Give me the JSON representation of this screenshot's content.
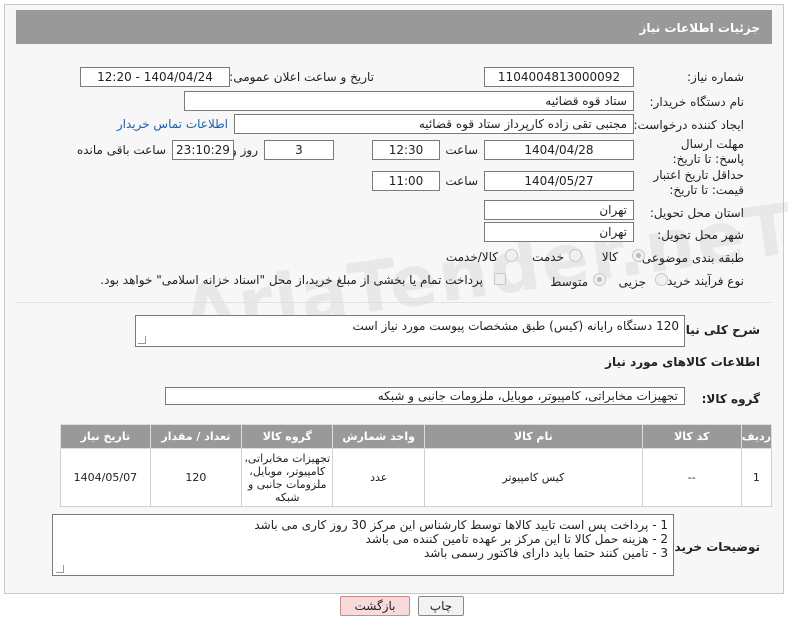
{
  "header": {
    "title": "جزئیات اطلاعات نیاز"
  },
  "fields": {
    "need_number_label": "شماره نیاز:",
    "need_number": "1104004813000092",
    "announce_label": "تاریخ و ساعت اعلان عمومی:",
    "announce_value": "1404/04/24 - 12:20",
    "buyer_org_label": "نام دستگاه خریدار:",
    "buyer_org": "ستاد قوه قضائیه",
    "creator_label": "ایجاد کننده درخواست:",
    "creator": "مجتبی تقی زاده کارپرداز ستاد قوه قضائیه",
    "contact_link": "اطلاعات تماس خریدار",
    "reply_deadline_label": "مهلت ارسال پاسخ: تا تاریخ:",
    "reply_date": "1404/04/28",
    "time_label": "ساعت",
    "reply_time": "12:30",
    "days_value": "3",
    "days_label": "روز و",
    "remaining_time": "23:10:29",
    "remaining_label": "ساعت باقی مانده",
    "price_validity_label": "حداقل تاریخ اعتبار قیمت: تا تاریخ:",
    "price_date": "1404/05/27",
    "time_label2": "ساعت",
    "price_time": "11:00",
    "province_label": "استان محل تحویل:",
    "province": "تهران",
    "city_label": "شهر محل تحویل:",
    "city": "تهران",
    "category_label": "طبقه بندی موضوعی:",
    "category_goods": "کالا",
    "category_service": "خدمت",
    "category_both": "کالا/خدمت",
    "process_label": "نوع فرآیند خرید :",
    "process_partial": "جزیی",
    "process_medium": "متوسط",
    "payment_note": "پرداخت تمام یا بخشی از مبلغ خرید،از محل \"اسناد خزانه اسلامی\" خواهد بود."
  },
  "description": {
    "label": "شرح کلی نیاز:",
    "text": "120 دستگاه رایانه (کیس) طبق مشخصات پیوست مورد نیاز است"
  },
  "goods_section": {
    "title": "اطلاعات کالاهای مورد نیاز",
    "group_label": "گروه کالا:",
    "group_value": "تجهیزات مخابراتی، کامپیوتر، موبایل، ملزومات جانبی و شبکه"
  },
  "table": {
    "headers": [
      "ردیف",
      "کد کالا",
      "نام کالا",
      "واحد شمارش",
      "گروه کالا",
      "تعداد / مقدار",
      "تاریخ نیاز"
    ],
    "rows": [
      [
        "1",
        "--",
        "کیس کامپیوتر",
        "عدد",
        "تجهیزات مخابراتی، کامپیوتر، موبایل، ملزومات جانبی و شبکه",
        "120",
        "1404/05/07"
      ]
    ]
  },
  "buyer_notes": {
    "label": "توضیحات خریدار:",
    "lines": [
      "1 - پرداخت پس است تایید کالاها توسط کارشناس این مرکز 30 روز کاری می باشد",
      "2 - هزینه حمل کالا تا این مرکز بر عهده تامین کننده می باشد",
      "3 - تامین کنند حتما باید دارای فاکتور رسمی باشد"
    ]
  },
  "buttons": {
    "print": "چاپ",
    "back": "بازگشت"
  },
  "watermark": "AriaTender.neT"
}
